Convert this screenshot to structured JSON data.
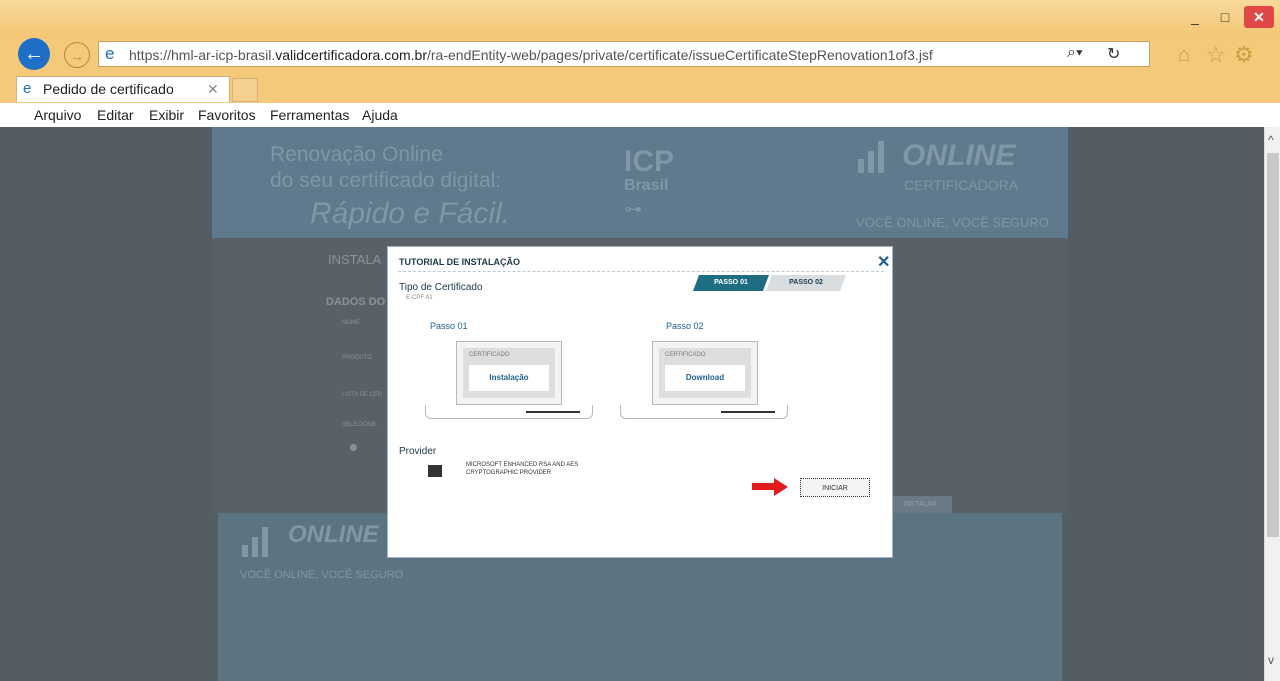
{
  "window": {
    "minimize": "_",
    "maximize": "□",
    "close": "✕"
  },
  "nav": {
    "back": "←",
    "forward": "→",
    "url_prefix": "https://hml-ar-icp-brasil.",
    "url_domain": "validcertificadora.com.br",
    "url_path": "/ra-endEntity-web/pages/private/certificate/issueCertificateStepRenovation1of3.jsf"
  },
  "tab": {
    "label": "Pedido de certificado",
    "close": "✕"
  },
  "menu": [
    "Arquivo",
    "Editar",
    "Exibir",
    "Favoritos",
    "Ferramentas",
    "Ajuda"
  ],
  "page": {
    "header_line1": "Renovação Online",
    "header_line2": "do seu certificado digital:",
    "header_line3": "Rápido e Fácil.",
    "icp": "ICP",
    "brasil": "Brasil",
    "brand": "ONLINE",
    "brand_sub": "CERTIFICADORA",
    "slogan": "VOCÊ ONLINE, VOCÊ SEGURO",
    "instala": "INSTALA",
    "dados": "DADOS DO",
    "nome": "NOME",
    "produto": "PRODUTO",
    "lista": "LISTA DE CER",
    "selecione": "SELECIONE",
    "instalar": "INSTALAR",
    "footer_slogan": "VOCÊ ONLINE, VOCÊ SEGURO"
  },
  "modal": {
    "title": "TUTORIAL DE INSTALAÇÃO",
    "close": "✕",
    "tab1": "PASSO 01",
    "tab2": "PASSO 02",
    "tipo_label": "Tipo de Certificado",
    "tipo_value": "E-CPF A1",
    "passo1_title": "Passo 01",
    "passo2_title": "Passo 02",
    "cert_label": "CERTIFICADO",
    "passo1_button": "Instalação",
    "passo2_button": "Download",
    "provider_label": "Provider",
    "provider_name": "MICROSOFT ENHANCED RSA AND AES CRYPTOGRAPHIC PROVIDER",
    "iniciar": "INICIAR"
  },
  "colors": {
    "chrome": "#f5c97a",
    "modal_accent": "#1f6d83",
    "arrow": "#e01c1c"
  }
}
